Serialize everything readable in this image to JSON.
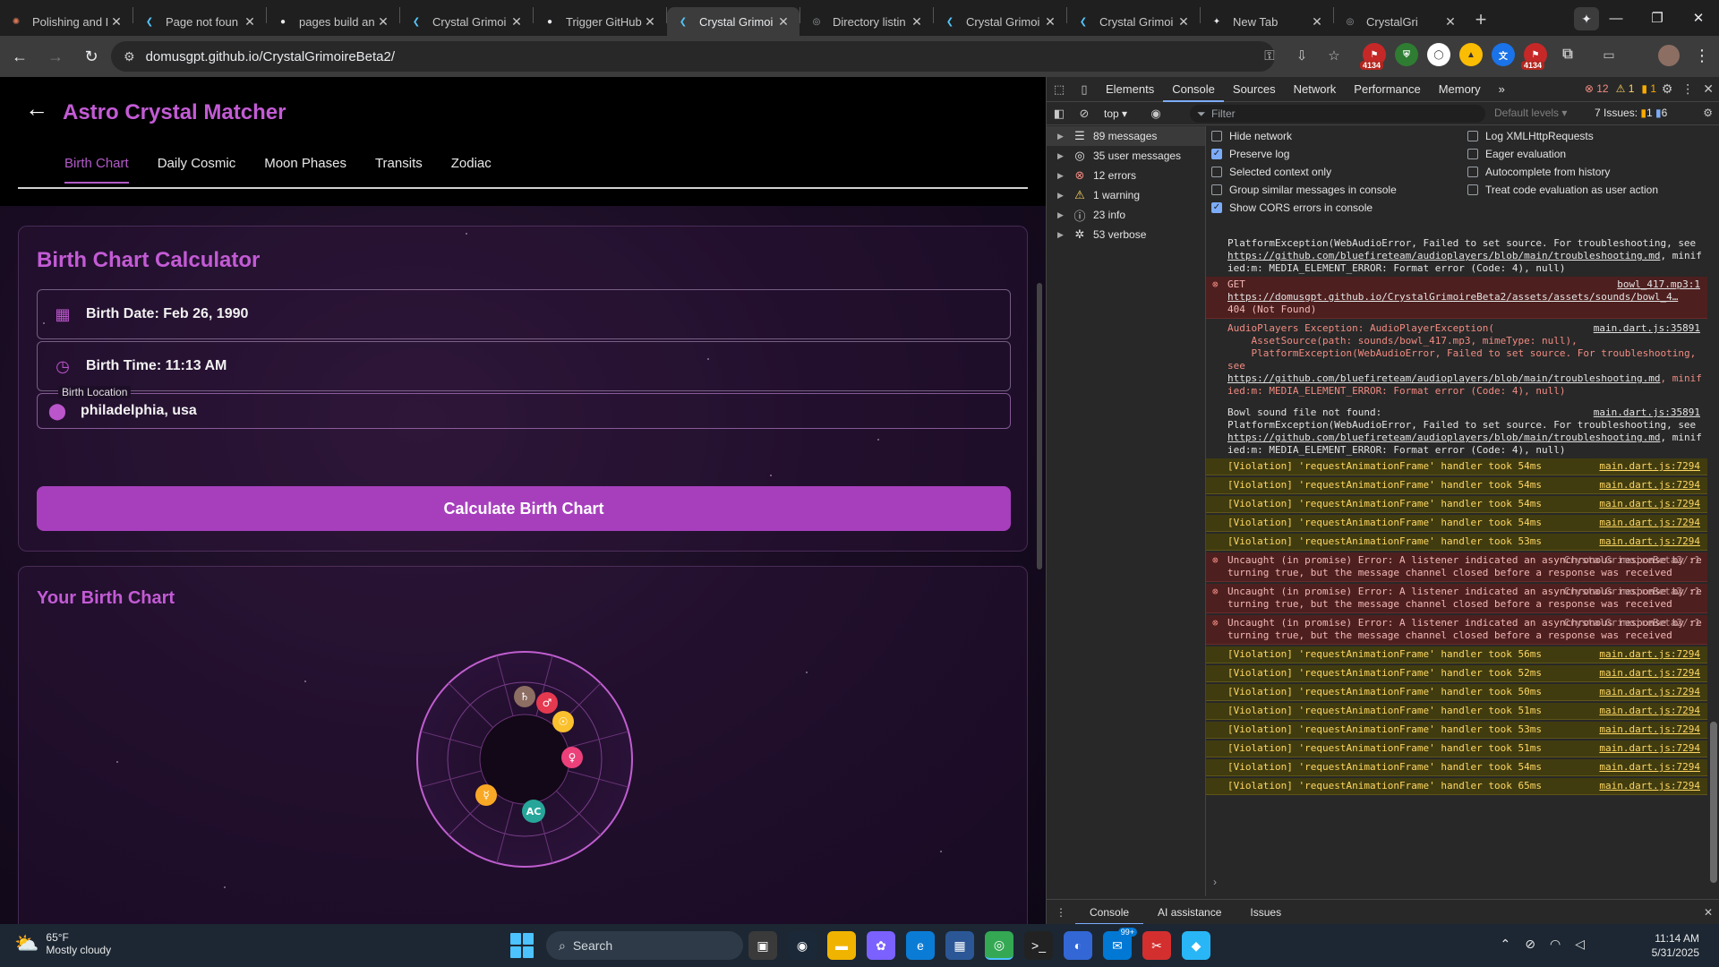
{
  "browser": {
    "tabs": [
      {
        "title": "Polishing and I",
        "favicon": "claude-icon",
        "color": "#d97757"
      },
      {
        "title": "Page not foun",
        "favicon": "flutter-icon",
        "color": "#54c5f8"
      },
      {
        "title": "pages build an",
        "favicon": "github-icon",
        "color": "#e8eaed"
      },
      {
        "title": "Crystal Grimoi",
        "favicon": "flutter-icon",
        "color": "#54c5f8"
      },
      {
        "title": "Trigger GitHub",
        "favicon": "github-icon",
        "color": "#e8eaed"
      },
      {
        "title": "Crystal Grimoi",
        "favicon": "flutter-icon",
        "color": "#54c5f8",
        "active": true
      },
      {
        "title": "Directory listin",
        "favicon": "globe-icon",
        "color": "#9aa0a6"
      },
      {
        "title": "Crystal Grimoi",
        "favicon": "flutter-icon",
        "color": "#54c5f8"
      },
      {
        "title": "Crystal Grimoi",
        "favicon": "flutter-icon",
        "color": "#54c5f8"
      },
      {
        "title": "New Tab",
        "favicon": "chatgpt-icon",
        "color": "#e8eaed"
      },
      {
        "title": "CrystalGri",
        "favicon": "globe-icon",
        "color": "#9aa0a6"
      }
    ],
    "url": "domusgpt.github.io/CrystalGrimoireBeta2/",
    "extension_badge": "4134"
  },
  "app": {
    "title": "Astro Crystal Matcher",
    "tabs": [
      "Birth Chart",
      "Daily Cosmic",
      "Moon Phases",
      "Transits",
      "Zodiac"
    ],
    "selected_tab": "Birth Chart",
    "calculator": {
      "title": "Birth Chart Calculator",
      "birth_date": "Birth Date: Feb 26, 1990",
      "birth_time": "Birth Time: 11:13 AM",
      "location_label": "Birth Location",
      "location_value": "philadelphia, usa",
      "button": "Calculate Birth Chart"
    },
    "chart": {
      "title": "Your Birth Chart",
      "planets": [
        {
          "symbol": "♄",
          "name": "saturn",
          "color": "#8d6e63"
        },
        {
          "symbol": "♂",
          "name": "mars",
          "color": "#e53950"
        },
        {
          "symbol": "☉",
          "name": "sun",
          "color": "#fbc02d"
        },
        {
          "symbol": "♀",
          "name": "venus",
          "color": "#ec407a"
        },
        {
          "symbol": "☿",
          "name": "mercury",
          "color": "#f9a825"
        },
        {
          "symbol": "AC",
          "name": "ascendant",
          "color": "#26a69a"
        }
      ]
    },
    "accent": "#c35bd5"
  },
  "devtools": {
    "tabs": [
      "Elements",
      "Console",
      "Sources",
      "Network",
      "Performance",
      "Memory"
    ],
    "selected_tab": "Console",
    "error_count": "12",
    "warning_count": "1",
    "info_count": "1",
    "context": "top",
    "filter_placeholder": "Filter",
    "levels": "Default levels",
    "issues_label": "7 Issues:",
    "issues_err": "1",
    "issues_info": "6",
    "sidebar": [
      {
        "label": "89 messages",
        "icon": "list-icon"
      },
      {
        "label": "35 user messages",
        "icon": "user-icon"
      },
      {
        "label": "12 errors",
        "icon": "error-icon"
      },
      {
        "label": "1 warning",
        "icon": "warning-icon"
      },
      {
        "label": "23 info",
        "icon": "info-icon"
      },
      {
        "label": "53 verbose",
        "icon": "bug-icon"
      }
    ],
    "settings": {
      "hide_network": "Hide network",
      "preserve_log": "Preserve log",
      "selected_context": "Selected context only",
      "group_similar": "Group similar messages in console",
      "show_cors": "Show CORS errors in console",
      "log_xhr": "Log XMLHttpRequests",
      "eager_eval": "Eager evaluation",
      "autocomplete": "Autocomplete from history",
      "treat_code_eval": "Treat code evaluation as user action"
    },
    "messages": {
      "m0": "PlatformException(WebAudioError, Failed to set source. For troubleshooting, see",
      "m0_link": "https://github.com/bluefireteam/audioplayers/blob/main/troubleshooting.md",
      "m0_tail": ", minified:m: MEDIA_ELEMENT_ERROR: Format error (Code: 4), null)",
      "get_label": "GET",
      "get_src": "bowl_417.mp3:1",
      "get_url": "https://domusgpt.github.io/CrystalGrimoireBeta2/assets/assets/sounds/bowl_4…",
      "get_status": "404 (Not Found)",
      "ap_exc": "AudioPlayers Exception: AudioPlayerException(\n    AssetSource(path: sounds/bowl_417.mp3, mimeType: null),\n    PlatformException(WebAudioError, Failed to set source. For troubleshooting, see",
      "ap_link": "https://github.com/bluefireteam/audioplayers/blob/main/troubleshooting.md",
      "ap_tail": ", minified:m: MEDIA_ELEMENT_ERROR: Format error (Code: 4), null)",
      "src_35891": "main.dart.js:35891",
      "bowl_nf": "Bowl sound file not found:\nPlatformException(WebAudioError, Failed to set source. For troubleshooting, see",
      "bowl_link": "https://github.com/bluefireteam/audioplayers/blob/main/troubleshooting.md",
      "bowl_tail": ", minified:m: MEDIA_ELEMENT_ERROR: Format error (Code: 4), null)",
      "src_7294": "main.dart.js:7294",
      "src_cg": "CrystalGrimoireBeta2/:1",
      "uncaught": "Uncaught (in promise) Error: A listener indicated an asynchronous response by returning true, but the message channel closed before a response was received",
      "v54": "[Violation] 'requestAnimationFrame' handler took 54ms",
      "v53": "[Violation] 'requestAnimationFrame' handler took 53ms",
      "v56": "[Violation] 'requestAnimationFrame' handler took 56ms",
      "v52": "[Violation] 'requestAnimationFrame' handler took 52ms",
      "v50": "[Violation] 'requestAnimationFrame' handler took 50ms",
      "v51": "[Violation] 'requestAnimationFrame' handler took 51ms",
      "v65": "[Violation] 'requestAnimationFrame' handler took 65ms"
    },
    "drawer_tabs": [
      "Console",
      "AI assistance",
      "Issues"
    ]
  },
  "taskbar": {
    "temp": "65°F",
    "weather": "Mostly cloudy",
    "search": "Search",
    "mail_badge": "99+",
    "time": "11:14 AM",
    "date": "5/31/2025"
  }
}
